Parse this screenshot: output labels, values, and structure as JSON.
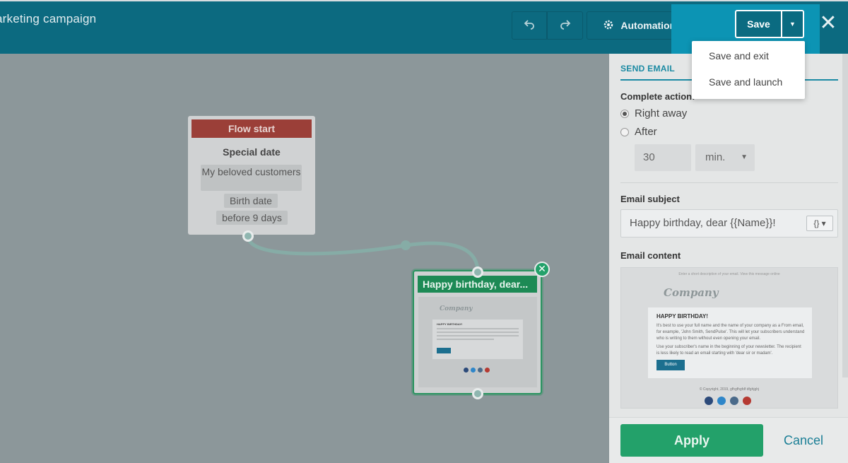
{
  "header": {
    "title": "arketing campaign",
    "undo_icon": "undo-icon",
    "redo_icon": "redo-icon",
    "automation_label": "Automation options",
    "save_label": "Save",
    "close_icon": "close-icon"
  },
  "save_menu": {
    "items": [
      {
        "label": "Save and exit"
      },
      {
        "label": "Save and launch"
      }
    ]
  },
  "canvas": {
    "flow_start": {
      "header": "Flow start",
      "title": "Special date",
      "tags": [
        "My beloved customers",
        "Birth date",
        "before 9 days"
      ]
    },
    "email_node": {
      "header": "Happy birthday, dear..."
    }
  },
  "panel": {
    "section": "SEND EMAIL",
    "complete_action_label": "Complete action:",
    "options": [
      {
        "label": "Right away",
        "selected": true
      },
      {
        "label": "After",
        "selected": false
      }
    ],
    "delay_value": "30",
    "delay_unit": "min.",
    "subject_label": "Email subject",
    "subject_value": "Happy birthday, dear {{Name}}!",
    "variables_button": "{}",
    "content_label": "Email content",
    "preview": {
      "top_line": "Enter a short description of your email. View this message online",
      "logo": "Company",
      "heading": "HAPPY BIRTHDAY!",
      "paragraph1": "It's best to use your full name and the name of your company as a From email, for example, 'John Smith, SendPulse'. This will let your subscribers understand who is writing to them without even opening your email.",
      "paragraph2": "Use your subscriber's name in the beginning of your newsletter. The recipient is less likely to read an email starting with 'dear sir or madam'.",
      "button": "Button",
      "copyright": "© Copyright, 2019, gfhgfhgfdf dfghjghj"
    },
    "apply_label": "Apply",
    "cancel_label": "Cancel"
  },
  "colors": {
    "header": "#0c6a80",
    "flow_start": "#9b3f38",
    "email_node": "#1d8a55",
    "apply": "#23a16a",
    "accent": "#1b8aa3"
  }
}
